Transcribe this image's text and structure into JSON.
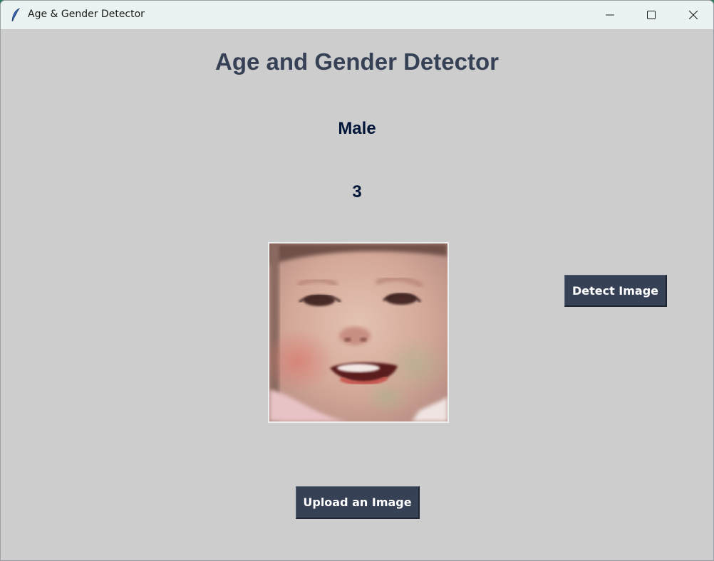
{
  "window": {
    "title": "Age & Gender Detector",
    "icon": "feather-icon",
    "controls": [
      "minimize-icon",
      "maximize-icon",
      "close-icon"
    ]
  },
  "main": {
    "heading": "Age and Gender Detector",
    "gender_result": "Male",
    "age_result": "3",
    "image": "uploaded-face-photo",
    "detect_button": "Detect Image",
    "upload_button": "Upload an Image"
  },
  "colors": {
    "background": "#cdcdcd",
    "heading": "#364156",
    "result_text": "#011638",
    "button_bg": "#364156",
    "button_text": "#ffffff",
    "titlebar": "#eaf3f1"
  }
}
